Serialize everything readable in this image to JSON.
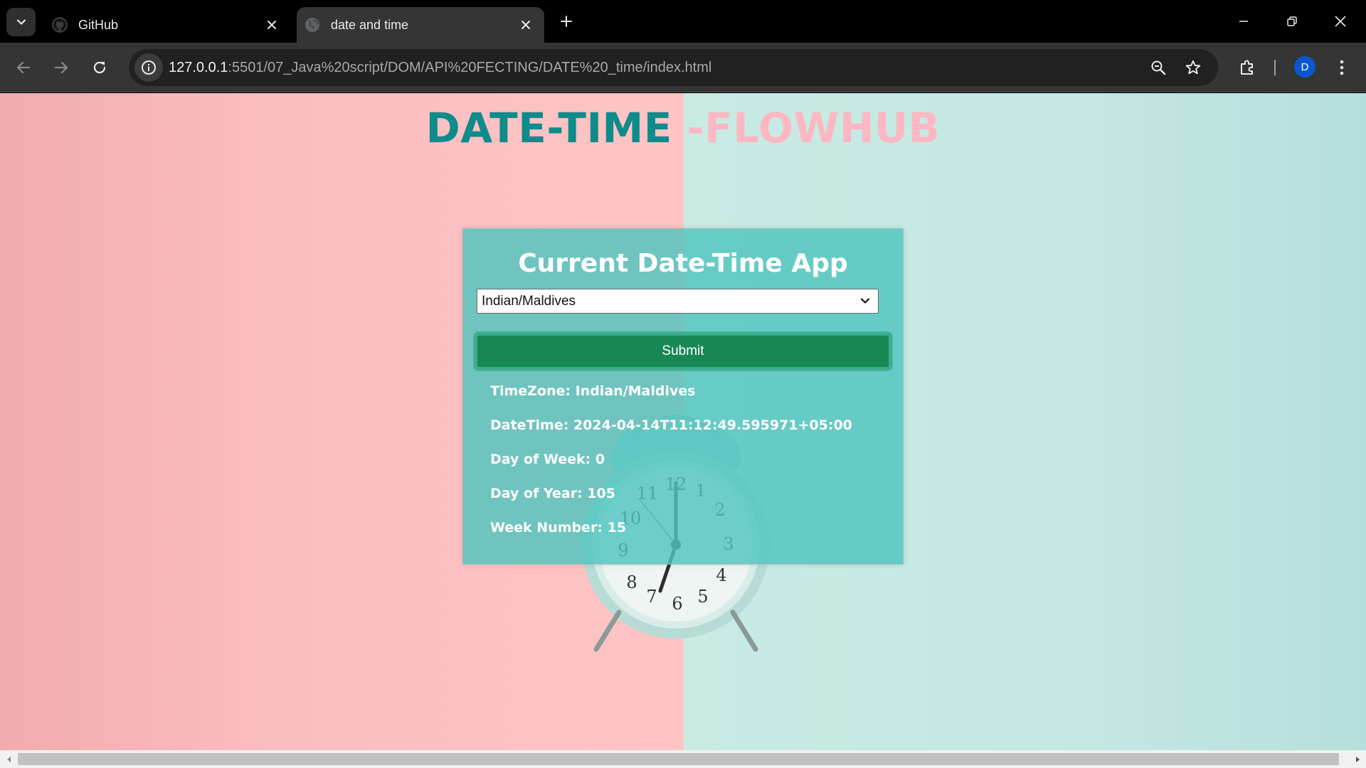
{
  "browser": {
    "tabs": [
      {
        "title": "GitHub",
        "icon": "github-icon",
        "active": false
      },
      {
        "title": "date and time",
        "icon": "globe-icon",
        "active": true
      }
    ],
    "url_host": "127.0.0.1",
    "url_rest": ":5501/07_Java%20script/DOM/API%20FECTING/DATE%20_time/index.html",
    "profile_initial": "D"
  },
  "page": {
    "heading_part1": "DATE-TIME",
    "heading_part2": "-FLOWHUB",
    "card_title": "Current Date-Time App",
    "timezone_select_value": "Indian/Maldives",
    "submit_label": "Submit",
    "info": {
      "timezone": "TimeZone: Indian/Maldives",
      "datetime": "DateTime: 2024-04-14T11:12:49.595971+05:00",
      "day_of_week": "Day of Week: 0",
      "day_of_year": "Day of Year: 105",
      "week_number": "Week Number: 15"
    }
  },
  "colors": {
    "heading_primary": "#0e8b8b",
    "heading_secondary": "#fbb8c2",
    "submit_bg": "#198754",
    "card_bg": "#50c4be"
  }
}
